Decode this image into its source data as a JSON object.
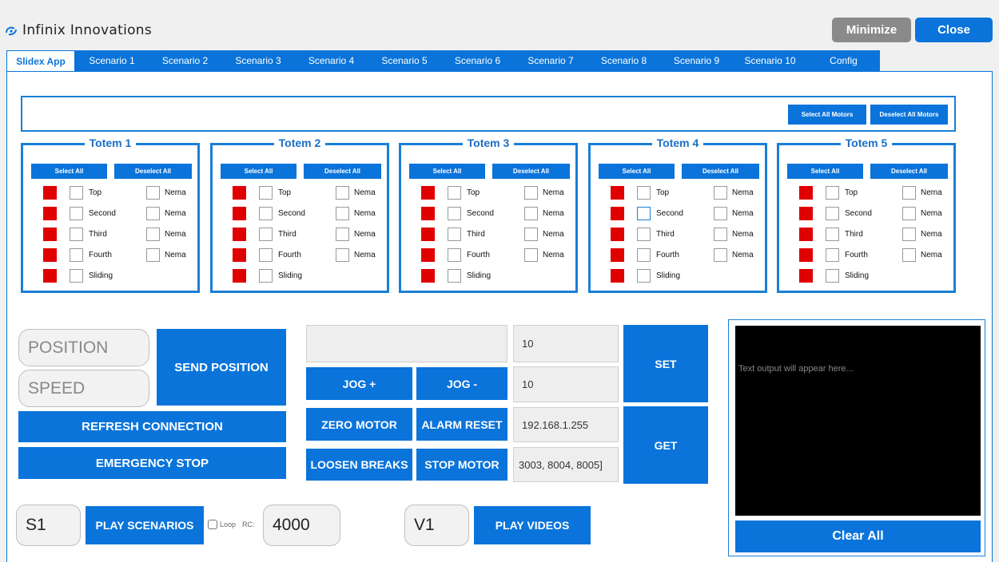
{
  "header": {
    "app_name": "Infinix Innovations",
    "minimize_label": "Minimize",
    "close_label": "Close"
  },
  "tabs": [
    {
      "label": "Slidex App",
      "active": true
    },
    {
      "label": "Scenario 1"
    },
    {
      "label": "Scenario 2"
    },
    {
      "label": "Scenario 3"
    },
    {
      "label": "Scenario 4"
    },
    {
      "label": "Scenario 5"
    },
    {
      "label": "Scenario 6"
    },
    {
      "label": "Scenario 7"
    },
    {
      "label": "Scenario 8"
    },
    {
      "label": "Scenario 9"
    },
    {
      "label": "Scenario 10"
    },
    {
      "label": "Config"
    }
  ],
  "motors": {
    "select_all_label": "Select All Motors",
    "deselect_all_label": "Deselect All Motors"
  },
  "totem_common": {
    "select_all": "Select All",
    "deselect_all": "Deselect All",
    "rows": [
      "Top",
      "Second",
      "Third",
      "Fourth",
      "Sliding"
    ],
    "nema_label": "Nema"
  },
  "totems": [
    {
      "title": "Totem 1"
    },
    {
      "title": "Totem 2"
    },
    {
      "title": "Totem 3"
    },
    {
      "title": "Totem 4"
    },
    {
      "title": "Totem 5"
    }
  ],
  "controls": {
    "position_placeholder": "POSITION",
    "speed_placeholder": "SPEED",
    "send_position": "SEND POSITION",
    "refresh_connection": "REFRESH CONNECTION",
    "emergency_stop": "EMERGENCY STOP",
    "jog_plus": "JOG +",
    "jog_minus": "JOG -",
    "zero_motor": "ZERO MOTOR",
    "alarm_reset": "ALARM RESET",
    "loosen_breaks": "LOOSEN BREAKS",
    "stop_motor": "STOP MOTOR",
    "set": "SET",
    "get": "GET",
    "field_value_1": "10",
    "field_value_2": "10",
    "ip_address": "192.168.1.255",
    "ports": "3003, 8004, 8005]"
  },
  "output": {
    "placeholder": "Text output will appear here...",
    "clear_all": "Clear All"
  },
  "scenario": {
    "value": "S1",
    "play_label": "PLAY SCENARIOS",
    "loop_label": "Loop",
    "rc_label": "RC:",
    "rc_value": "4000"
  },
  "video": {
    "value": "V1",
    "play_label": "PLAY VIDEOS"
  },
  "colors": {
    "accent": "#0a74da",
    "motor_indicator": "#e00000",
    "output_bg": "#000000"
  }
}
